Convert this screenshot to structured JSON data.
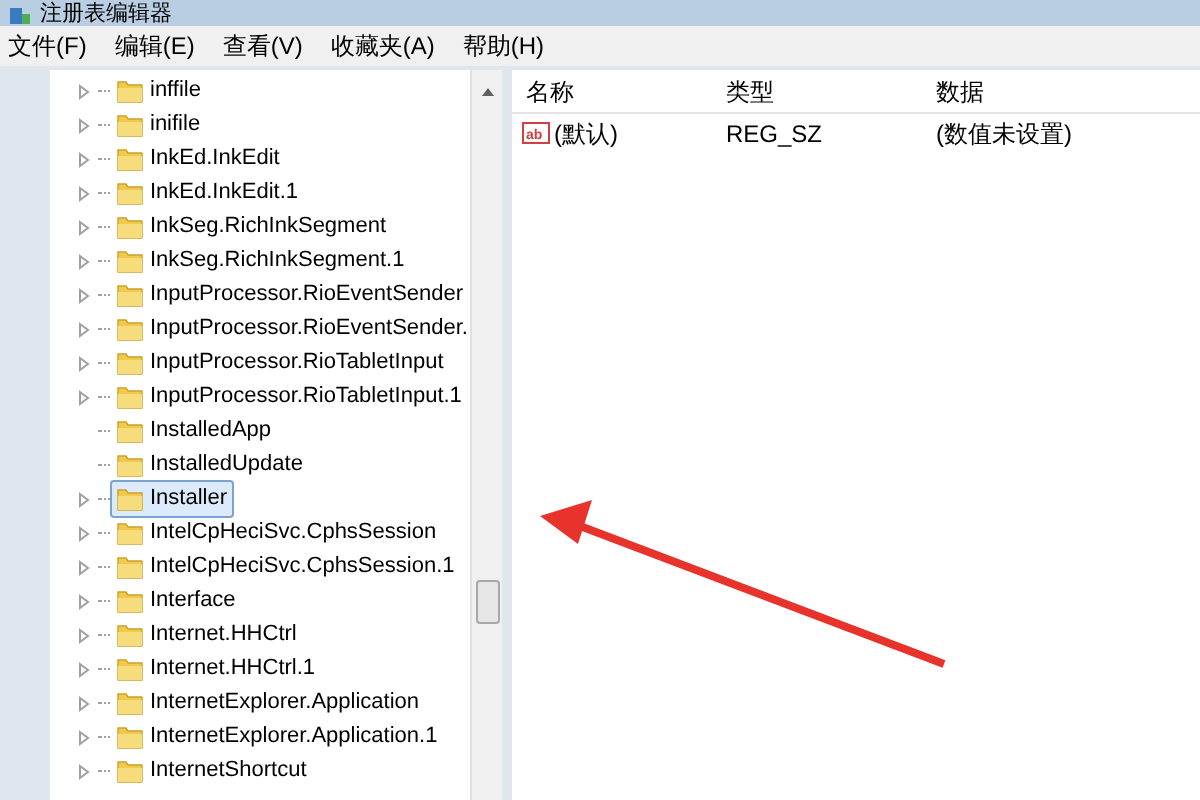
{
  "window": {
    "title": "注册表编辑器"
  },
  "menu": [
    "文件(F)",
    "编辑(E)",
    "查看(V)",
    "收藏夹(A)",
    "帮助(H)"
  ],
  "tree": {
    "items": [
      {
        "label": "inffile",
        "expandable": true,
        "selected": false
      },
      {
        "label": "inifile",
        "expandable": true,
        "selected": false
      },
      {
        "label": "InkEd.InkEdit",
        "expandable": true,
        "selected": false
      },
      {
        "label": "InkEd.InkEdit.1",
        "expandable": true,
        "selected": false
      },
      {
        "label": "InkSeg.RichInkSegment",
        "expandable": true,
        "selected": false
      },
      {
        "label": "InkSeg.RichInkSegment.1",
        "expandable": true,
        "selected": false
      },
      {
        "label": "InputProcessor.RioEventSender",
        "expandable": true,
        "selected": false
      },
      {
        "label": "InputProcessor.RioEventSender.",
        "expandable": true,
        "selected": false
      },
      {
        "label": "InputProcessor.RioTabletInput",
        "expandable": true,
        "selected": false
      },
      {
        "label": "InputProcessor.RioTabletInput.1",
        "expandable": true,
        "selected": false
      },
      {
        "label": "InstalledApp",
        "expandable": false,
        "selected": false
      },
      {
        "label": "InstalledUpdate",
        "expandable": false,
        "selected": false
      },
      {
        "label": "Installer",
        "expandable": true,
        "selected": true
      },
      {
        "label": "IntelCpHeciSvc.CphsSession",
        "expandable": true,
        "selected": false
      },
      {
        "label": "IntelCpHeciSvc.CphsSession.1",
        "expandable": true,
        "selected": false
      },
      {
        "label": "Interface",
        "expandable": true,
        "selected": false
      },
      {
        "label": "Internet.HHCtrl",
        "expandable": true,
        "selected": false
      },
      {
        "label": "Internet.HHCtrl.1",
        "expandable": true,
        "selected": false
      },
      {
        "label": "InternetExplorer.Application",
        "expandable": true,
        "selected": false
      },
      {
        "label": "InternetExplorer.Application.1",
        "expandable": true,
        "selected": false
      },
      {
        "label": "InternetShortcut",
        "expandable": true,
        "selected": false
      }
    ]
  },
  "values": {
    "columns": [
      "名称",
      "类型",
      "数据"
    ],
    "rows": [
      {
        "icon_text": "ab",
        "name": "(默认)",
        "type": "REG_SZ",
        "data": "(数值未设置)"
      }
    ]
  }
}
